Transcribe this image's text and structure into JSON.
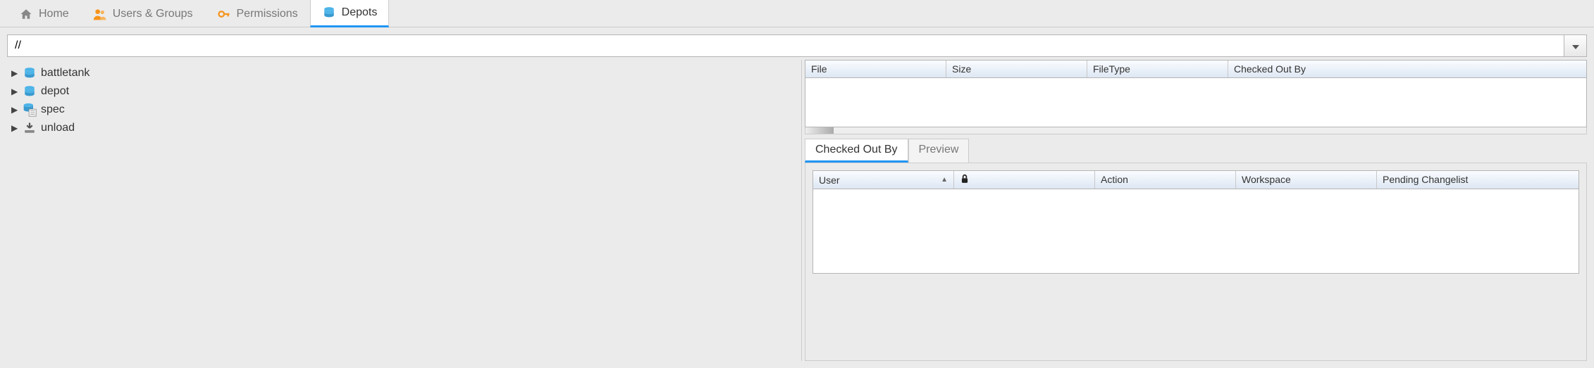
{
  "tabs": [
    {
      "label": "Home",
      "active": false
    },
    {
      "label": "Users & Groups",
      "active": false
    },
    {
      "label": "Permissions",
      "active": false
    },
    {
      "label": "Depots",
      "active": true
    }
  ],
  "path_input": {
    "value": "//"
  },
  "tree": [
    {
      "name": "battletank",
      "icon": "depot"
    },
    {
      "name": "depot",
      "icon": "depot"
    },
    {
      "name": "spec",
      "icon": "spec"
    },
    {
      "name": "unload",
      "icon": "unload"
    }
  ],
  "file_grid": {
    "columns": [
      "File",
      "Size",
      "FileType",
      "Checked Out By"
    ]
  },
  "sub_tabs": [
    {
      "label": "Checked Out By",
      "active": true
    },
    {
      "label": "Preview",
      "active": false
    }
  ],
  "checkout_grid": {
    "columns": [
      "User",
      "",
      "Action",
      "Workspace",
      "Pending Changelist"
    ],
    "sort_col": 0
  }
}
